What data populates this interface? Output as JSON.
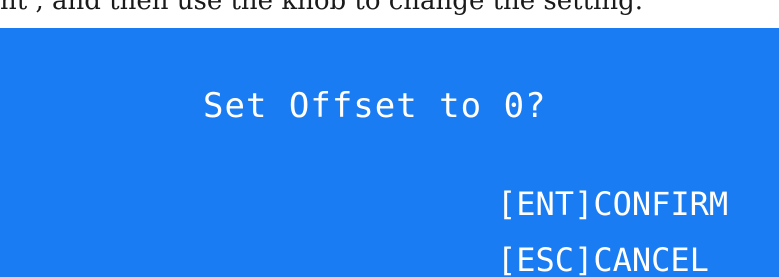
{
  "header": {
    "fragment": "nt , and then use the knob to change the setting."
  },
  "dialog": {
    "message": "Set Offset to 0?",
    "options": [
      {
        "label": "[ENT]CONFIRM"
      },
      {
        "label": "[ESC]CANCEL"
      }
    ]
  },
  "colors": {
    "screen_background": "#1a7cf2",
    "text": "#ffffff"
  }
}
